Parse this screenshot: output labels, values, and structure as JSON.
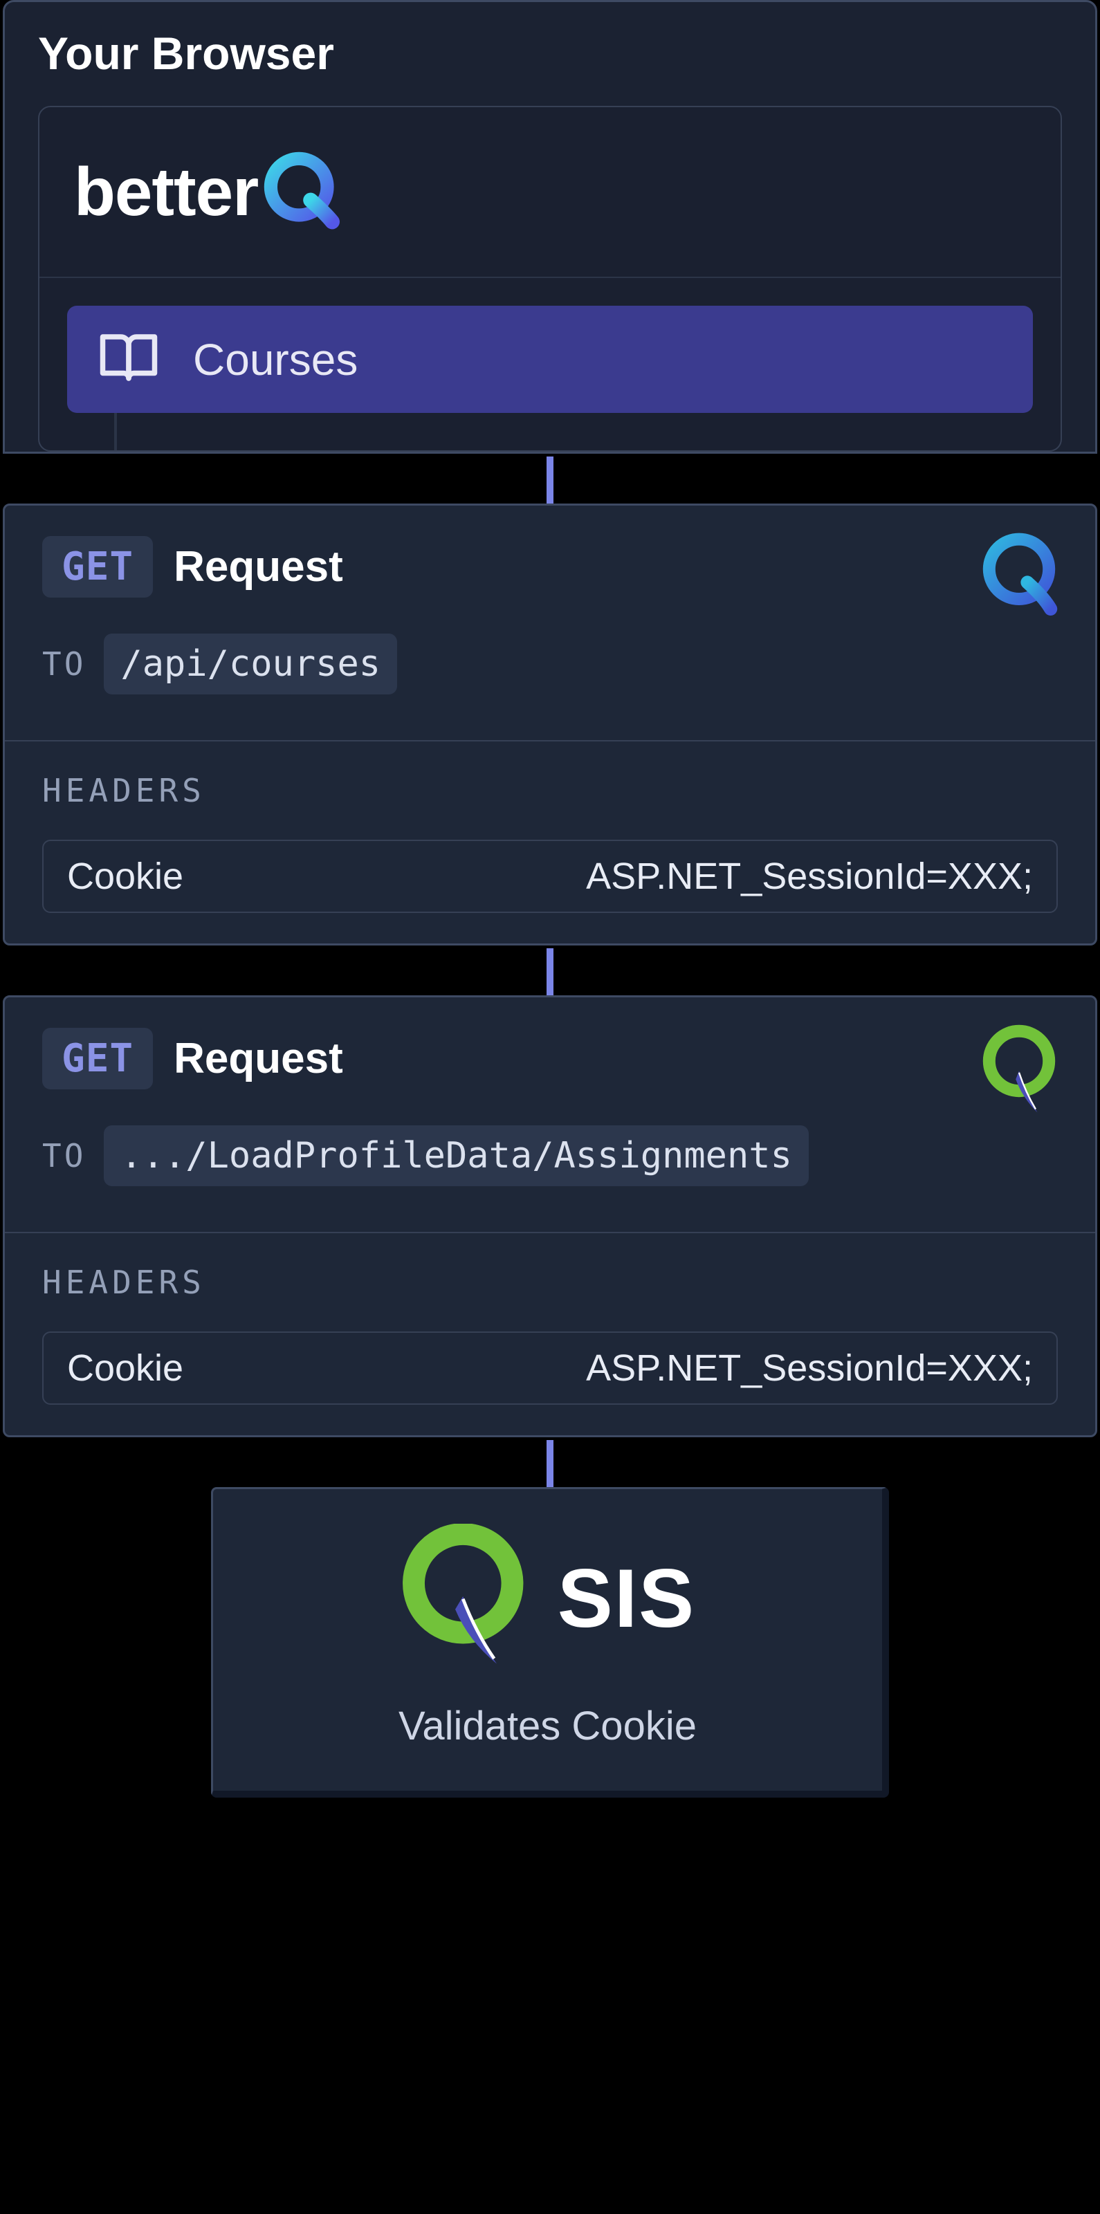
{
  "browser": {
    "title": "Your Browser",
    "logo_text": "better",
    "nav_item": "Courses"
  },
  "requests": [
    {
      "method": "GET",
      "label": "Request",
      "to_label": "TO",
      "path": "/api/courses",
      "headers_label": "HEADERS",
      "header_key": "Cookie",
      "header_value": "ASP.NET_SessionId=XXX;",
      "icon": "q-blue"
    },
    {
      "method": "GET",
      "label": "Request",
      "to_label": "TO",
      "path": ".../LoadProfileData/Assignments",
      "headers_label": "HEADERS",
      "header_key": "Cookie",
      "header_value": "ASP.NET_SessionId=XXX;",
      "icon": "q-green"
    }
  ],
  "sis": {
    "label": "SIS",
    "subtitle": "Validates Cookie"
  }
}
